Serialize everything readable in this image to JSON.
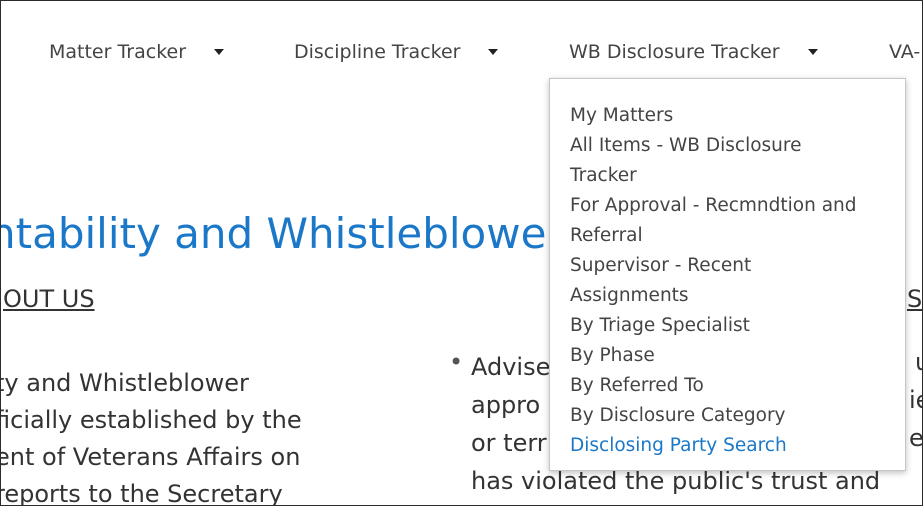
{
  "nav": {
    "items": [
      {
        "label": "Matter Tracker"
      },
      {
        "label": "Discipline Tracker"
      },
      {
        "label": "WB Disclosure Tracker"
      },
      {
        "label": "VA-"
      }
    ]
  },
  "page": {
    "title": "ntability and Whistleblowe",
    "about_heading": "OUT US",
    "right_heading_fragment": "S",
    "left_body": [
      "ty and Whistleblower",
      "ficially established by the",
      "ent of Veterans Affairs on",
      "reports to the Secretary"
    ],
    "bullet_lines": [
      "Advise",
      "appro",
      "or terr",
      "has violated the public's trust and"
    ],
    "right_fragments": [
      "u",
      "ie",
      "er"
    ]
  },
  "dropdown": {
    "items": [
      {
        "lines": [
          "My Matters"
        ]
      },
      {
        "lines": [
          "All Items - WB Disclosure",
          "Tracker"
        ]
      },
      {
        "lines": [
          "For Approval - Recmndtion and",
          "Referral"
        ]
      },
      {
        "lines": [
          "Supervisor - Recent",
          "Assignments"
        ]
      },
      {
        "lines": [
          "By Triage Specialist"
        ]
      },
      {
        "lines": [
          "By Phase"
        ]
      },
      {
        "lines": [
          "By Referred To"
        ]
      },
      {
        "lines": [
          "By Disclosure Category"
        ]
      },
      {
        "lines": [
          "Disclosing Party Search"
        ],
        "active": true
      }
    ]
  },
  "colors": {
    "accent": "#1b78c8",
    "nav_text": "#444444",
    "body_text": "#333333"
  }
}
